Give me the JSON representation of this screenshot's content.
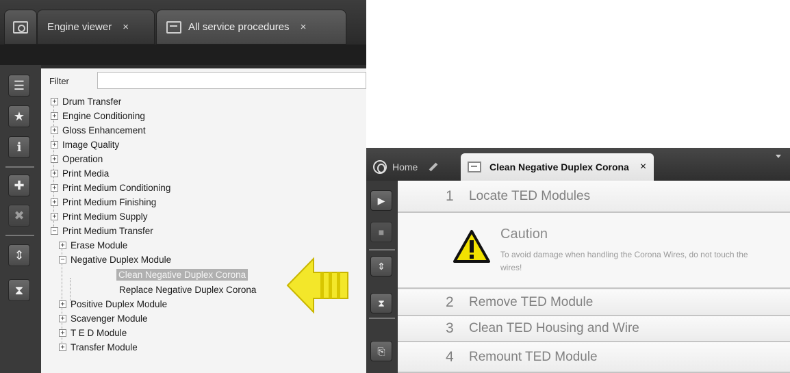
{
  "left": {
    "tabs": [
      {
        "label": "Engine viewer",
        "close": "×"
      },
      {
        "label": "All service procedures",
        "close": "×"
      }
    ],
    "filter": {
      "label": "Filter",
      "value": ""
    },
    "toolbar_icons": [
      "list-icon",
      "star-icon",
      "info-icon",
      "bookmark-add-icon",
      "bookmark-remove-icon",
      "expand-collapse-icon",
      "hourglass-icon"
    ],
    "tree": {
      "nodes": [
        {
          "label": "Drum Transfer",
          "toggle": "+"
        },
        {
          "label": "Engine Conditioning",
          "toggle": "+"
        },
        {
          "label": "Gloss Enhancement",
          "toggle": "+"
        },
        {
          "label": "Image Quality",
          "toggle": "+"
        },
        {
          "label": "Operation",
          "toggle": "+"
        },
        {
          "label": "Print Media",
          "toggle": "+"
        },
        {
          "label": "Print Medium Conditioning",
          "toggle": "+"
        },
        {
          "label": "Print Medium Finishing",
          "toggle": "+"
        },
        {
          "label": "Print Medium Supply",
          "toggle": "+"
        },
        {
          "label": "Print Medium Transfer",
          "toggle": "−"
        },
        {
          "label": "Erase Module",
          "toggle": "+"
        },
        {
          "label": "Negative Duplex Module",
          "toggle": "−"
        },
        {
          "label": "Clean Negative Duplex Corona",
          "toggle": ""
        },
        {
          "label": "Replace Negative Duplex Corona",
          "toggle": ""
        },
        {
          "label": "Positive Duplex Module",
          "toggle": "+"
        },
        {
          "label": "Scavenger Module",
          "toggle": "+"
        },
        {
          "label": "T E D Module",
          "toggle": "+"
        },
        {
          "label": "Transfer Module",
          "toggle": "+"
        }
      ],
      "selected": "Clean Negative Duplex Corona"
    }
  },
  "right": {
    "tabs": [
      {
        "label": "Home"
      },
      {
        "label": "Clean Negative Duplex Corona",
        "close": "×"
      }
    ],
    "steps": [
      {
        "number": "1",
        "title": "Locate TED Modules"
      },
      {
        "number": "2",
        "title": "Remove TED Module"
      },
      {
        "number": "3",
        "title": "Clean TED Housing and Wire"
      },
      {
        "number": "4",
        "title": "Remount TED Module"
      }
    ],
    "caution": {
      "title": "Caution",
      "text": "To avoid damage when handling the Corona Wires, do not touch the wires!"
    }
  },
  "colors": {
    "arrow": "#f3e72a",
    "warning": "#f2e200",
    "dark_chrome": "#2c2c2c",
    "panel": "#f4f4f4",
    "selection": "#b0b0b0"
  }
}
